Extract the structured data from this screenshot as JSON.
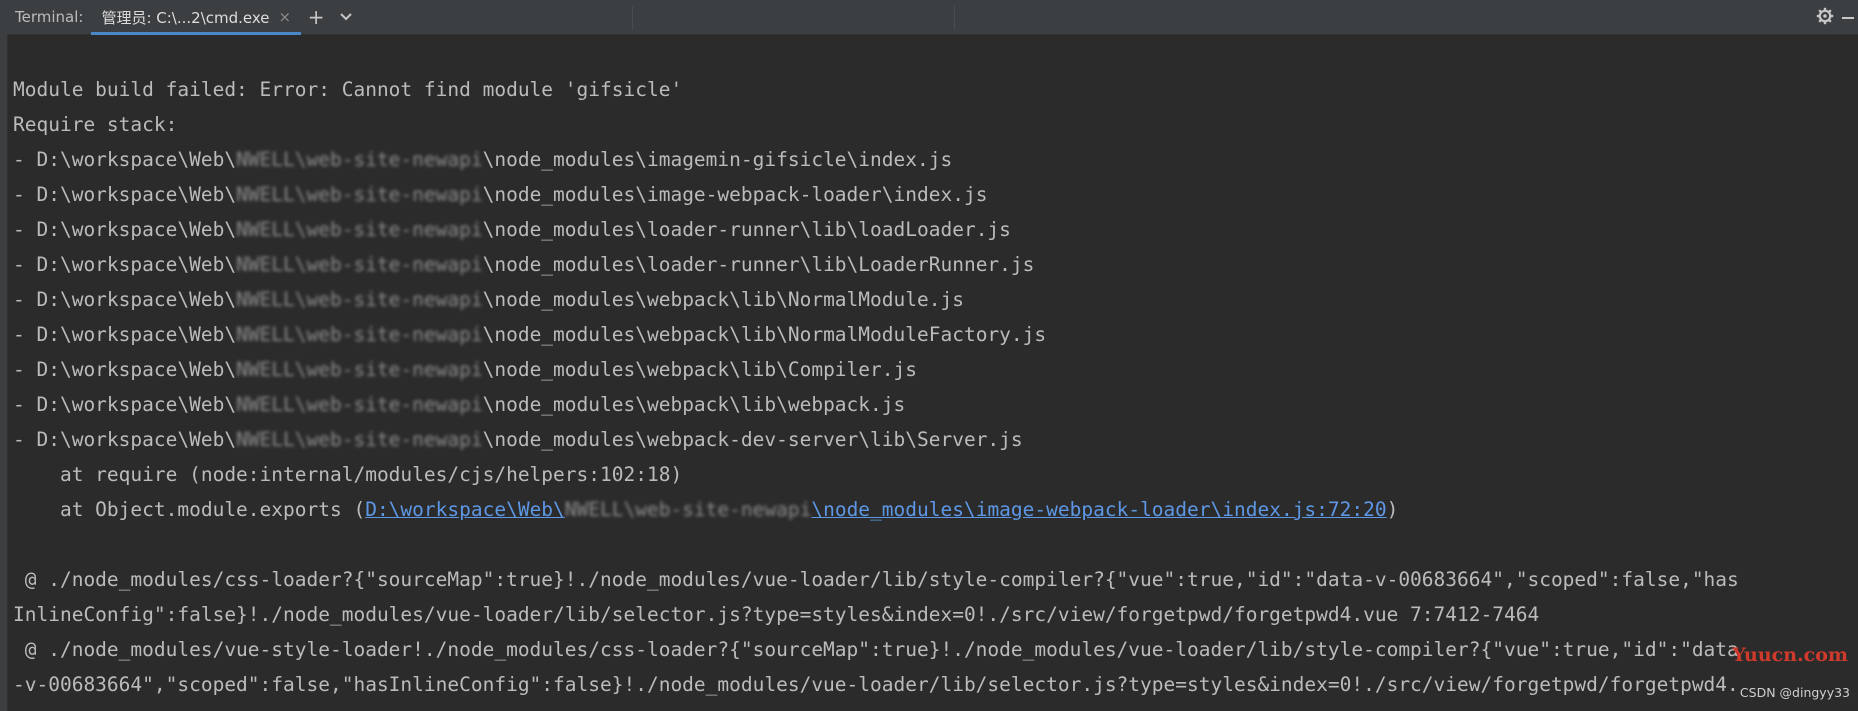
{
  "tabbar": {
    "label": "Terminal:",
    "active_tab": "管理员: C:\\...2\\cmd.exe",
    "close_glyph": "×",
    "add_glyph": "+",
    "dropdown_glyph": "⌄",
    "settings_icon": "gear-icon",
    "minimize_icon": "minimize-icon",
    "settings_glyph": "⚙",
    "minimize_glyph": "—"
  },
  "terminal": {
    "lines": [
      {
        "pre": "Module build failed: Error: Cannot find module 'gifsicle'"
      },
      {
        "pre": "Require stack:"
      },
      {
        "pre": "- D:\\workspace\\Web\\",
        "blur": "NWELL\\web-site-newapi",
        "post": "\\node_modules\\imagemin-gifsicle\\index.js"
      },
      {
        "pre": "- D:\\workspace\\Web\\",
        "blur": "NWELL\\web-site-newapi",
        "post": "\\node_modules\\image-webpack-loader\\index.js"
      },
      {
        "pre": "- D:\\workspace\\Web\\",
        "blur": "NWELL\\web-site-newapi",
        "post": "\\node_modules\\loader-runner\\lib\\loadLoader.js"
      },
      {
        "pre": "- D:\\workspace\\Web\\",
        "blur": "NWELL\\web-site-newapi",
        "post": "\\node_modules\\loader-runner\\lib\\LoaderRunner.js"
      },
      {
        "pre": "- D:\\workspace\\Web\\",
        "blur": "NWELL\\web-site-newapi",
        "post": "\\node_modules\\webpack\\lib\\NormalModule.js"
      },
      {
        "pre": "- D:\\workspace\\Web\\",
        "blur": "NWELL\\web-site-newapi",
        "post": "\\node_modules\\webpack\\lib\\NormalModuleFactory.js"
      },
      {
        "pre": "- D:\\workspace\\Web\\",
        "blur": "NWELL\\web-site-newapi",
        "post": "\\node_modules\\webpack\\lib\\Compiler.js"
      },
      {
        "pre": "- D:\\workspace\\Web\\",
        "blur": "NWELL\\web-site-newapi",
        "post": "\\node_modules\\webpack\\lib\\webpack.js"
      },
      {
        "pre": "- D:\\workspace\\Web\\",
        "blur": "NWELL\\web-site-newapi",
        "post": "\\node_modules\\webpack-dev-server\\lib\\Server.js"
      },
      {
        "pre": "    at require (node:internal/modules/cjs/helpers:102:18)"
      },
      {
        "pre": "    at Object.module.exports (",
        "link_pre": "D:\\workspace\\Web\\",
        "link_blur": "NWELL\\web-site-newapi",
        "link_post": "\\node_modules\\image-webpack-loader\\index.js:72:20",
        "post": ")"
      },
      {
        "pre": ""
      },
      {
        "pre": " @ ./node_modules/css-loader?{\"sourceMap\":true}!./node_modules/vue-loader/lib/style-compiler?{\"vue\":true,\"id\":\"data-v-00683664\",\"scoped\":false,\"has"
      },
      {
        "pre": "InlineConfig\":false}!./node_modules/vue-loader/lib/selector.js?type=styles&index=0!./src/view/forgetpwd/forgetpwd4.vue 7:7412-7464"
      },
      {
        "pre": " @ ./node_modules/vue-style-loader!./node_modules/css-loader?{\"sourceMap\":true}!./node_modules/vue-loader/lib/style-compiler?{\"vue\":true,\"id\":\"data"
      },
      {
        "pre": "-v-00683664\",\"scoped\":false,\"hasInlineConfig\":false}!./node_modules/vue-loader/lib/selector.js?type=styles&index=0!./src/view/forgetpwd/forgetpwd4."
      }
    ]
  },
  "watermark": {
    "site": "Yuucn.com",
    "author": "CSDN @dingyy33"
  }
}
